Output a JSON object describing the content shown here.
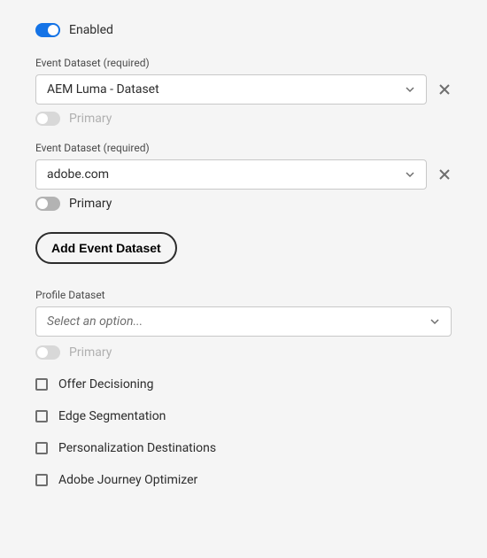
{
  "enabled": {
    "label": "Enabled"
  },
  "eventDatasetLabel": "Event Dataset (required)",
  "events": [
    {
      "value": "AEM Luma - Dataset",
      "primaryLabel": "Primary",
      "primaryEnabled": false
    },
    {
      "value": "adobe.com",
      "primaryLabel": "Primary",
      "primaryEnabled": true
    }
  ],
  "addEventDatasetLabel": "Add Event Dataset",
  "profileDataset": {
    "label": "Profile Dataset",
    "placeholder": "Select an option...",
    "primaryLabel": "Primary"
  },
  "checkboxes": [
    {
      "label": "Offer Decisioning"
    },
    {
      "label": "Edge Segmentation"
    },
    {
      "label": "Personalization Destinations"
    },
    {
      "label": "Adobe Journey Optimizer"
    }
  ]
}
